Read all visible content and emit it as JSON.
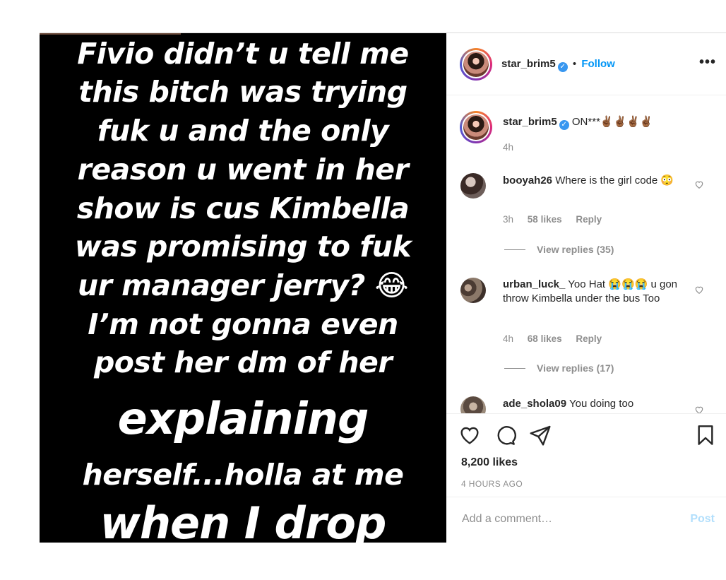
{
  "story": {
    "lines": [
      "Fivio didn’t u tell me",
      "this bitch was trying",
      "fuk u and the only",
      "reason u went in her",
      "show is cus Kimbella",
      "was promising to fuk",
      "ur manager jerry? 😂",
      "I’m not gonna even",
      "post her dm of her",
      "explaining",
      "herself...holla at me",
      "when I drop"
    ]
  },
  "header": {
    "username": "star_brim5",
    "separator": "•",
    "follow_label": "Follow",
    "more_label": "•••"
  },
  "caption": {
    "username": "star_brim5",
    "text": "ON***✌🏾✌🏾✌🏾✌🏾",
    "time": "4h"
  },
  "comments": [
    {
      "username": "booyah26",
      "text": "Where is the girl code 😳",
      "time": "3h",
      "likes": "58 likes",
      "reply": "Reply",
      "view_replies": "View replies (35)"
    },
    {
      "username": "urban_luck_",
      "text": "Yoo Hat 😭😭😭 u gon throw Kimbella under the bus Too",
      "time": "4h",
      "likes": "68 likes",
      "reply": "Reply",
      "view_replies": "View replies (17)"
    },
    {
      "username": "ade_shola09",
      "text": "You doing too"
    }
  ],
  "actions": {
    "likes": "8,200 likes",
    "time": "4 HOURS AGO"
  },
  "add_comment": {
    "placeholder": "Add a comment…",
    "post_label": "Post"
  },
  "colors": {
    "link_blue": "#0095f6",
    "verified_blue": "#3897f0",
    "post_disabled": "#b2dffc",
    "muted": "#8e8e8e"
  }
}
